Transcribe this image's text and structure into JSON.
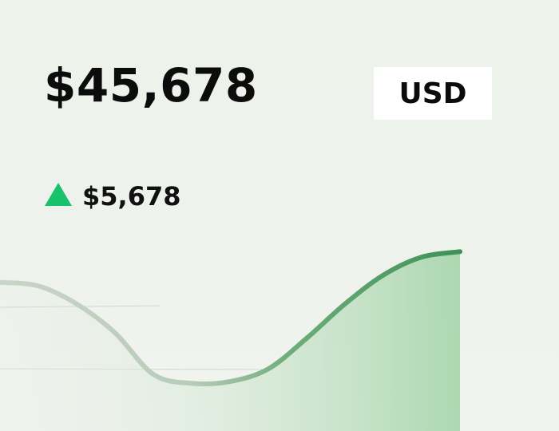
{
  "balance": {
    "amount": "$45,678",
    "currency": "USD"
  },
  "change": {
    "amount": "$5,678",
    "direction": "up",
    "icon": "triangle-up-icon",
    "color": "#17c26a"
  },
  "chart_data": {
    "type": "area",
    "title": "",
    "xlabel": "",
    "ylabel": "",
    "x": [
      0,
      1,
      2,
      3,
      4,
      5,
      6,
      7,
      8,
      9,
      10,
      11,
      12
    ],
    "series": [
      {
        "values": [
          0.78,
          0.76,
          0.66,
          0.5,
          0.27,
          0.22,
          0.23,
          0.3,
          0.47,
          0.66,
          0.82,
          0.92,
          0.95
        ]
      }
    ],
    "ylim": [
      0,
      1
    ],
    "grid": false,
    "legend": false,
    "colors": {
      "line": "#4a9a5f",
      "fill": "#9fd3a5",
      "faded": "#c9d4c8"
    }
  }
}
